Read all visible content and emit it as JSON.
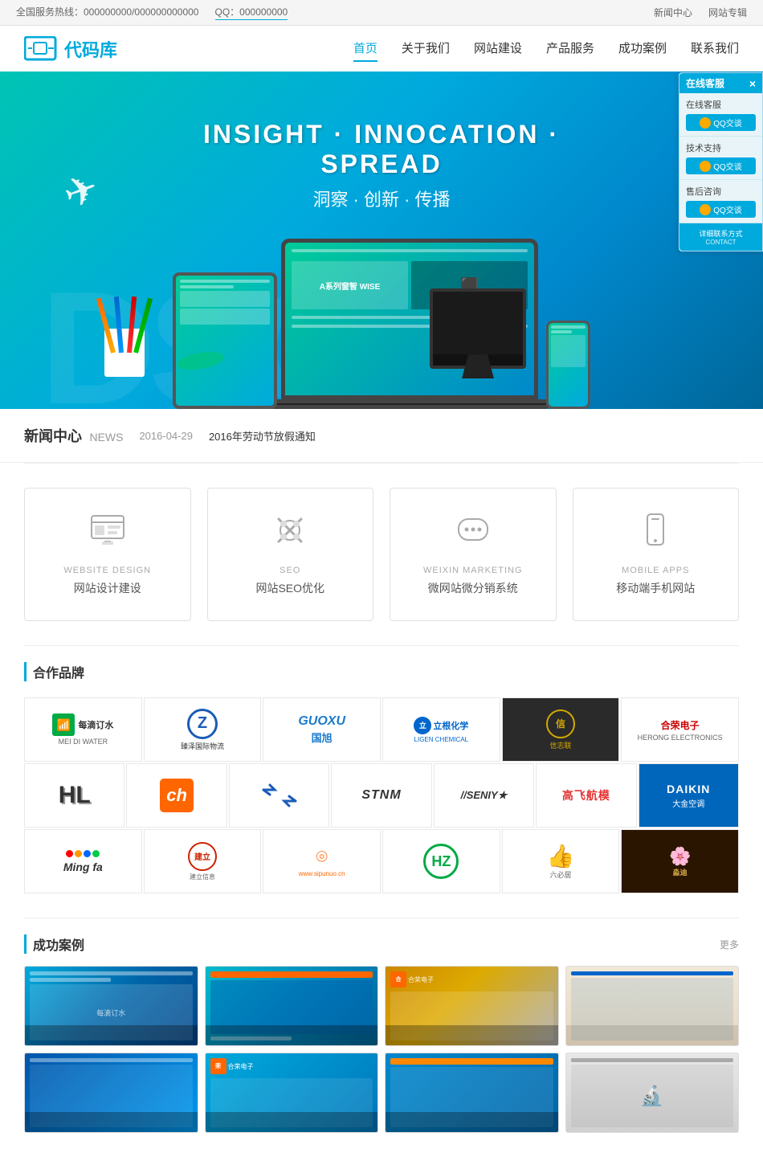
{
  "topbar": {
    "hotline_label": "全国服务热线：000000000/000000000000",
    "qq_label": "QQ：000000000",
    "nav_right": [
      "新闻中心",
      "网站专辑"
    ]
  },
  "header": {
    "logo_text": "代码库",
    "nav_items": [
      "首页",
      "关于我们",
      "网站建设",
      "产品服务",
      "成功案例",
      "联系我们"
    ]
  },
  "hero": {
    "title": "INSIGHT · INNOCATION · SPREAD",
    "subtitle": "洞察 · 创新 · 传播",
    "bg_text": "DSG"
  },
  "news": {
    "title": "新闻中心",
    "title_en": "NEWS",
    "date": "2016-04-29",
    "headline": "2016年劳动节放假通知"
  },
  "services": [
    {
      "icon": "🖥",
      "name_en": "WEBSITE DESIGN",
      "name_cn": "网站设计建设"
    },
    {
      "icon": "⚙",
      "name_en": "SEO",
      "name_cn": "网站SEO优化"
    },
    {
      "icon": "💬",
      "name_en": "WEIXIN MARKETING",
      "name_cn": "微网站微分销系统"
    },
    {
      "icon": "📱",
      "name_en": "MOBILE APPS",
      "name_cn": "移动端手机网站"
    }
  ],
  "partners": {
    "section_title": "合作品牌",
    "row1": [
      {
        "name": "每滴订水",
        "name_en": "MEI DI WATER",
        "style": "meidishui"
      },
      {
        "name": "臻泽国际物流",
        "style": "zhiyang"
      },
      {
        "name": "GUOXU 国旭",
        "style": "guoxu"
      },
      {
        "name": "立根化学 LIGEN CHEMICAL",
        "style": "ligen"
      },
      {
        "name": "信志联",
        "style": "xinzhi"
      },
      {
        "name": "合荣电子",
        "style": "herong"
      }
    ],
    "row2": [
      {
        "name": "HL",
        "style": "hl"
      },
      {
        "name": "ch",
        "style": "orange-box"
      },
      {
        "name": ">>",
        "style": "blue-arrows"
      },
      {
        "name": "STNM",
        "style": "stnm"
      },
      {
        "name": "SENIY",
        "style": "seniy"
      },
      {
        "name": "高飞航模",
        "style": "gaofei"
      },
      {
        "name": "DAIKIN 大金空调",
        "style": "daikin"
      }
    ],
    "row3": [
      {
        "name": "Ming fa",
        "style": "mingfa"
      },
      {
        "name": "建立信息",
        "style": "jianli"
      },
      {
        "name": "www.sipunuo.cn",
        "style": "sipunuo"
      },
      {
        "name": "HZ",
        "style": "hz"
      },
      {
        "name": "六必居",
        "style": "liubiju"
      },
      {
        "name": "淼迪",
        "style": "miaodi"
      }
    ]
  },
  "cases": {
    "section_title": "成功案例",
    "more_text": "更多",
    "items": [
      {
        "id": 1,
        "style": "case-1"
      },
      {
        "id": 2,
        "style": "case-2"
      },
      {
        "id": 3,
        "style": "case-3"
      },
      {
        "id": 4,
        "style": "case-4"
      },
      {
        "id": 5,
        "style": "case-5"
      },
      {
        "id": 6,
        "style": "case-6"
      },
      {
        "id": 7,
        "style": "case-7"
      },
      {
        "id": 8,
        "style": "case-8"
      }
    ]
  },
  "widget": {
    "title": "在线客服",
    "online_label": "在线客服",
    "support_label": "技术支持",
    "sale_label": "售后咨询",
    "contact_label": "详细联系方式\nCONTACT",
    "qq_btn_text": "QQ交谈"
  }
}
